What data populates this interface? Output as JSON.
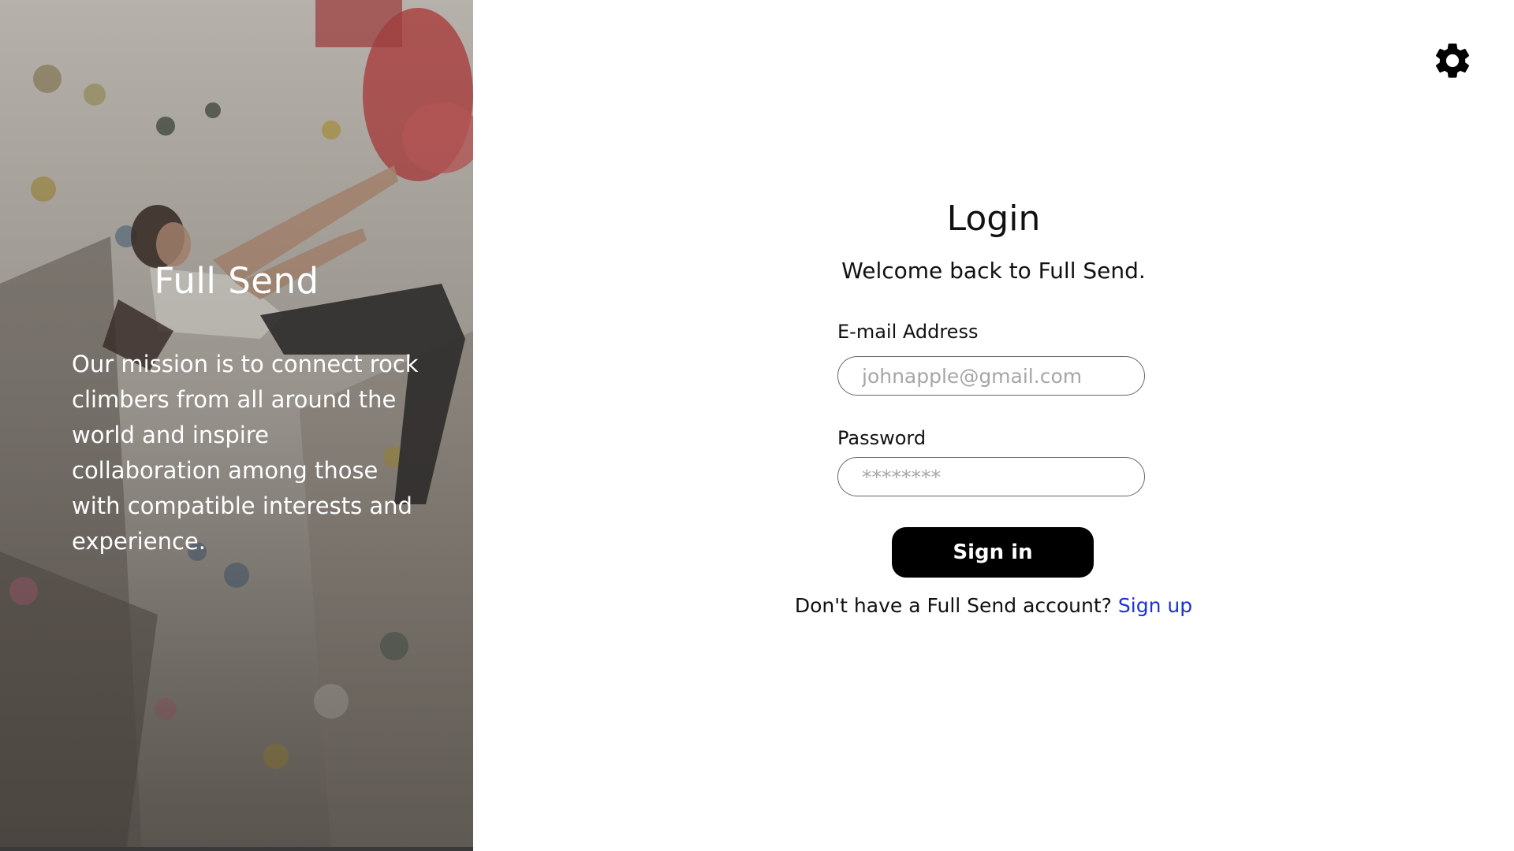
{
  "hero": {
    "title": "Full Send",
    "mission": "Our mission is to connect rock climbers from all around the world and inspire collaboration among those with compatible interests and experience."
  },
  "settings": {
    "icon": "gear-icon"
  },
  "login": {
    "title": "Login",
    "subtitle": "Welcome back to Full Send.",
    "email_label": "E-mail Address",
    "email_placeholder": "johnapple@gmail.com",
    "password_label": "Password",
    "password_placeholder": "********",
    "signin_label": "Sign in",
    "signup_prompt": "Don't have a Full Send account?",
    "signup_link": "Sign up"
  },
  "colors": {
    "button_bg": "#000000",
    "link": "#1a33d8",
    "input_border": "#666666"
  }
}
